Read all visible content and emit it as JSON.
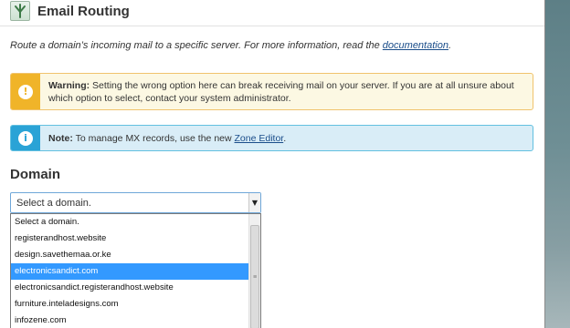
{
  "header": {
    "title": "Email Routing",
    "icon": "email-routing-icon"
  },
  "description": {
    "text": "Route a domain’s incoming mail to a specific server. For more information, read the ",
    "link": "documentation",
    "suffix": "."
  },
  "warning": {
    "label": "Warning:",
    "text": " Setting the wrong option here can break receiving mail on your server. If you are at all unsure about which option to select, contact your system administrator.",
    "icon": "exclamation-icon",
    "color": "#f0b429"
  },
  "note": {
    "label": "Note:",
    "text": " To manage MX records, use the new ",
    "link": "Zone Editor",
    "suffix": ".",
    "icon": "info-icon",
    "color": "#2aa3d6"
  },
  "domain": {
    "heading": "Domain",
    "select_value": "Select a domain.",
    "options": [
      "Select a domain.",
      "registerandhost.website",
      "design.savethemaa.or.ke",
      "electronicsandict.com",
      "electronicsandict.registerandhost.website",
      "furniture.inteladesigns.com",
      "infozene.com"
    ],
    "selected_index": 3
  }
}
